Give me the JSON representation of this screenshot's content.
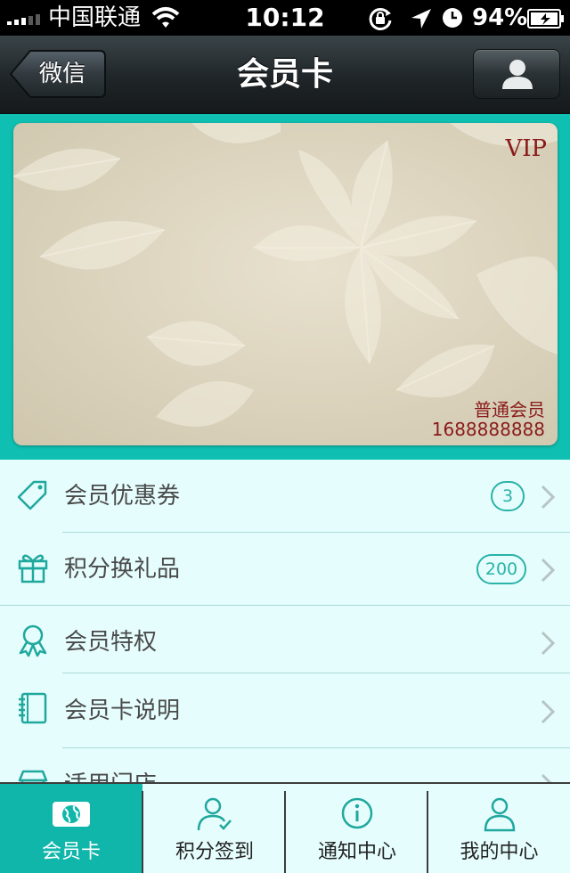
{
  "status_bar": {
    "carrier": "中国联通",
    "time": "10:12",
    "battery": "94%",
    "icons": [
      "signal-icon",
      "wifi-icon",
      "rotation-lock-icon",
      "location-icon",
      "alarm-icon",
      "battery-icon"
    ]
  },
  "nav": {
    "back_label": "微信",
    "title": "会员卡",
    "right_icon": "user-profile-icon"
  },
  "card": {
    "vip_label": "VIP",
    "member_level": "普通会员",
    "member_number": "1688888888"
  },
  "menu": {
    "items": [
      {
        "label": "会员优惠券",
        "badge": "3",
        "icon": "tag-icon"
      },
      {
        "label": "积分换礼品",
        "badge": "200",
        "icon": "gift-icon"
      },
      {
        "label": "会员特权",
        "icon": "award-ribbon-icon"
      },
      {
        "label": "会员卡说明",
        "icon": "notebook-icon"
      },
      {
        "label": "适用门店",
        "icon": "store-icon"
      }
    ]
  },
  "tabs": [
    {
      "label": "会员卡",
      "icon": "globe-icon",
      "active": true
    },
    {
      "label": "积分签到",
      "icon": "user-check-icon"
    },
    {
      "label": "通知中心",
      "icon": "info-icon"
    },
    {
      "label": "我的中心",
      "icon": "user-icon"
    }
  ],
  "colors": {
    "accent": "#11b6aa",
    "list_background": "#e6fdfd",
    "card_text": "#8a1a1a",
    "nav_bar": "#1f2528"
  }
}
